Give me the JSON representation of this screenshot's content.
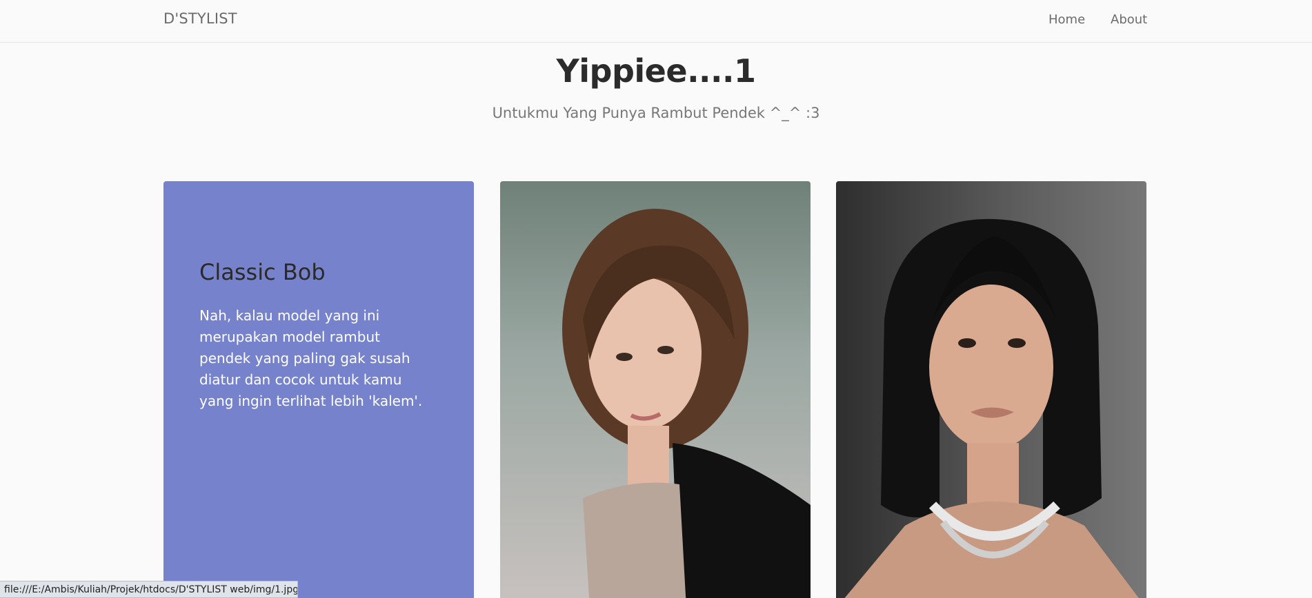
{
  "navbar": {
    "brand": "D'STYLIST",
    "links": [
      {
        "label": "Home"
      },
      {
        "label": "About"
      }
    ]
  },
  "hero": {
    "title": "Yippiee....1",
    "subtitle": "Untukmu Yang Punya Rambut Pendek ^_^ :3"
  },
  "card": {
    "title": "Classic Bob",
    "description": "Nah, kalau model yang ini merupakan model rambut pendek yang paling gak susah diatur dan cocok untuk kamu yang ingin terlihat lebih 'kalem'.",
    "background": "#7683cc"
  },
  "status_bar": {
    "url": "file:///E:/Ambis/Kuliah/Projek/htdocs/D'STYLIST web/img/1.jpg"
  }
}
